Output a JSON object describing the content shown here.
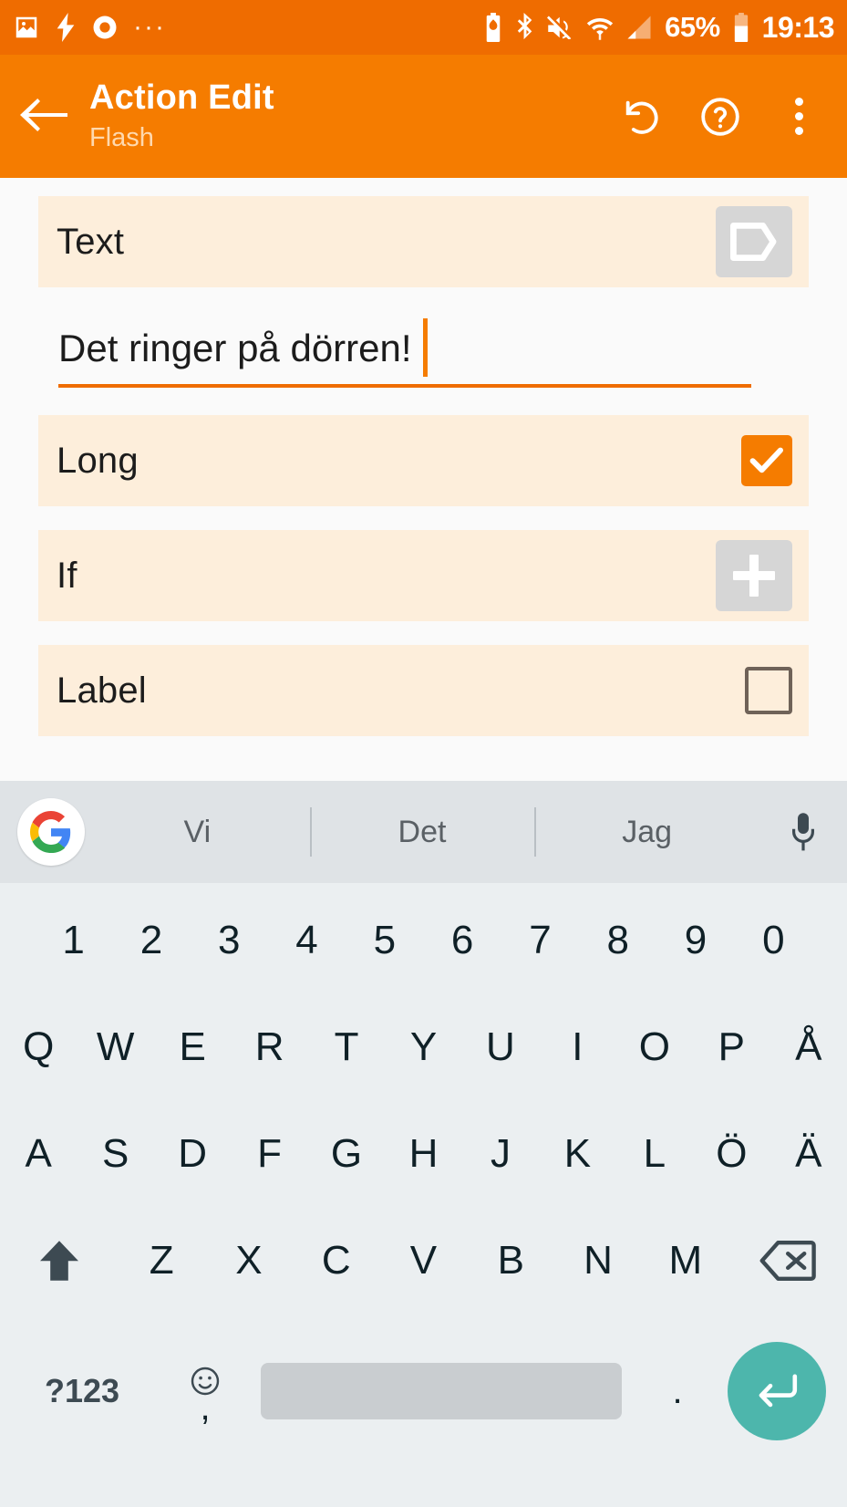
{
  "statusbar": {
    "left_icons": [
      "image-icon",
      "flash-icon",
      "ring-circle-icon",
      "more-dots-icon"
    ],
    "right_icons": [
      "battery-saver-icon",
      "bluetooth-icon",
      "mute-icon",
      "wifi-icon",
      "cell-signal-icon"
    ],
    "battery_percent": "65%",
    "time": "19:13",
    "bg_color": "#ef6c00"
  },
  "appbar": {
    "back_icon": "arrow-left-icon",
    "title": "Action Edit",
    "subtitle": "Flash",
    "undo_icon": "undo-icon",
    "help_icon": "help-circle-icon",
    "overflow_icon": "more-vertical-icon",
    "bg_color": "#f57c00"
  },
  "form": {
    "rows": [
      {
        "label": "Text",
        "control": "tag-button",
        "value": ""
      },
      {
        "label": "Long",
        "control": "checkbox-checked",
        "value": "checked"
      },
      {
        "label": "If",
        "control": "plus-button",
        "value": ""
      },
      {
        "label": "Label",
        "control": "checkbox-empty",
        "value": "unchecked"
      }
    ],
    "text_input": {
      "value": "Det ringer på dörren!",
      "placeholder": "",
      "caret_color": "#f57c00",
      "underline_color": "#ef6c00"
    },
    "row_bg_color": "#fdeedb",
    "accent_color": "#f57c00"
  },
  "keyboard": {
    "logo": "google-logo-icon",
    "suggestions": [
      "Vi",
      "Det",
      "Jag"
    ],
    "mic_icon": "microphone-icon",
    "rows": {
      "numbers": [
        "1",
        "2",
        "3",
        "4",
        "5",
        "6",
        "7",
        "8",
        "9",
        "0"
      ],
      "top": [
        "Q",
        "W",
        "E",
        "R",
        "T",
        "Y",
        "U",
        "I",
        "O",
        "P",
        "Å"
      ],
      "home": [
        "A",
        "S",
        "D",
        "F",
        "G",
        "H",
        "J",
        "K",
        "L",
        "Ö",
        "Ä"
      ],
      "bottom": [
        "Z",
        "X",
        "C",
        "V",
        "B",
        "N",
        "M"
      ]
    },
    "shift_icon": "shift-up-icon",
    "backspace_icon": "backspace-icon",
    "symbols_key": "?123",
    "emoji_icon": "emoji-smiley-icon",
    "comma_key": ",",
    "period_key": ".",
    "space_key": "",
    "enter_icon": "enter-return-icon",
    "enter_color": "#4db6ac",
    "bg_color": "#ebeff1",
    "suggest_bg_color": "#dfe3e6"
  }
}
